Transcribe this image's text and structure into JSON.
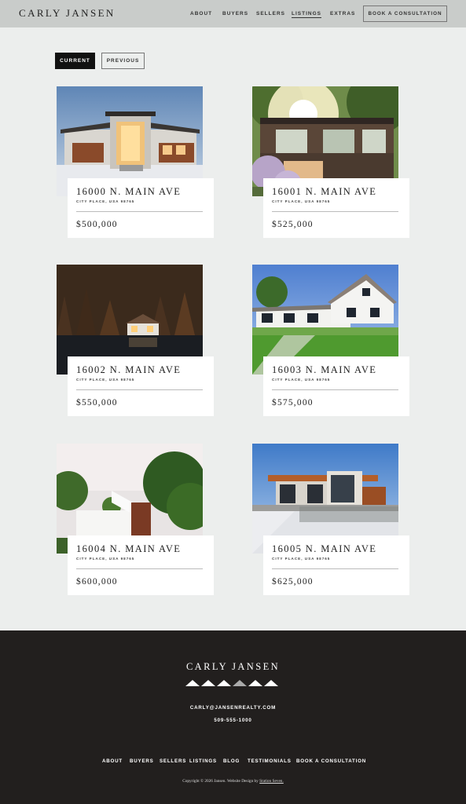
{
  "header": {
    "logo": "CARLY JANSEN",
    "nav": [
      "ABOUT",
      "BUYERS",
      "SELLERS",
      "LISTINGS",
      "EXTRAS"
    ],
    "active_nav": "LISTINGS",
    "cta": "BOOK A CONSULTATION"
  },
  "tabs": {
    "current": "CURRENT",
    "previous": "PREVIOUS",
    "selected": "CURRENT"
  },
  "listings": [
    {
      "address": "16000 N. MAIN AVE",
      "city": "CITY PLACE, USA 98765",
      "price": "$500,000"
    },
    {
      "address": "16001 N. MAIN AVE",
      "city": "CITY PLACE, USA 98765",
      "price": "$525,000"
    },
    {
      "address": "16002 N. MAIN AVE",
      "city": "CITY PLACE, USA 98765",
      "price": "$550,000"
    },
    {
      "address": "16003 N. MAIN AVE",
      "city": "CITY PLACE, USA 98765",
      "price": "$575,000"
    },
    {
      "address": "16004 N. MAIN AVE",
      "city": "CITY PLACE, USA 98765",
      "price": "$600,000"
    },
    {
      "address": "16005 N. MAIN AVE",
      "city": "CITY PLACE, USA 98765",
      "price": "$625,000"
    }
  ],
  "footer": {
    "logo": "CARLY JANSEN",
    "email": "CARLY@JANSENREALTY.COM",
    "phone": "509-555-1000",
    "nav": [
      "ABOUT",
      "BUYERS",
      "SELLERS",
      "LISTINGS",
      "BLOG",
      "TESTIMONIALS",
      "BOOK A CONSULTATION"
    ],
    "copyright": "Copyright © 2026 Jansen. Website Design by",
    "credit": "Station Seven."
  },
  "colors": {
    "header_bg": "#c9ccca",
    "page_bg": "#eceeed",
    "footer_bg": "#221f1e",
    "accent": "#111111"
  }
}
